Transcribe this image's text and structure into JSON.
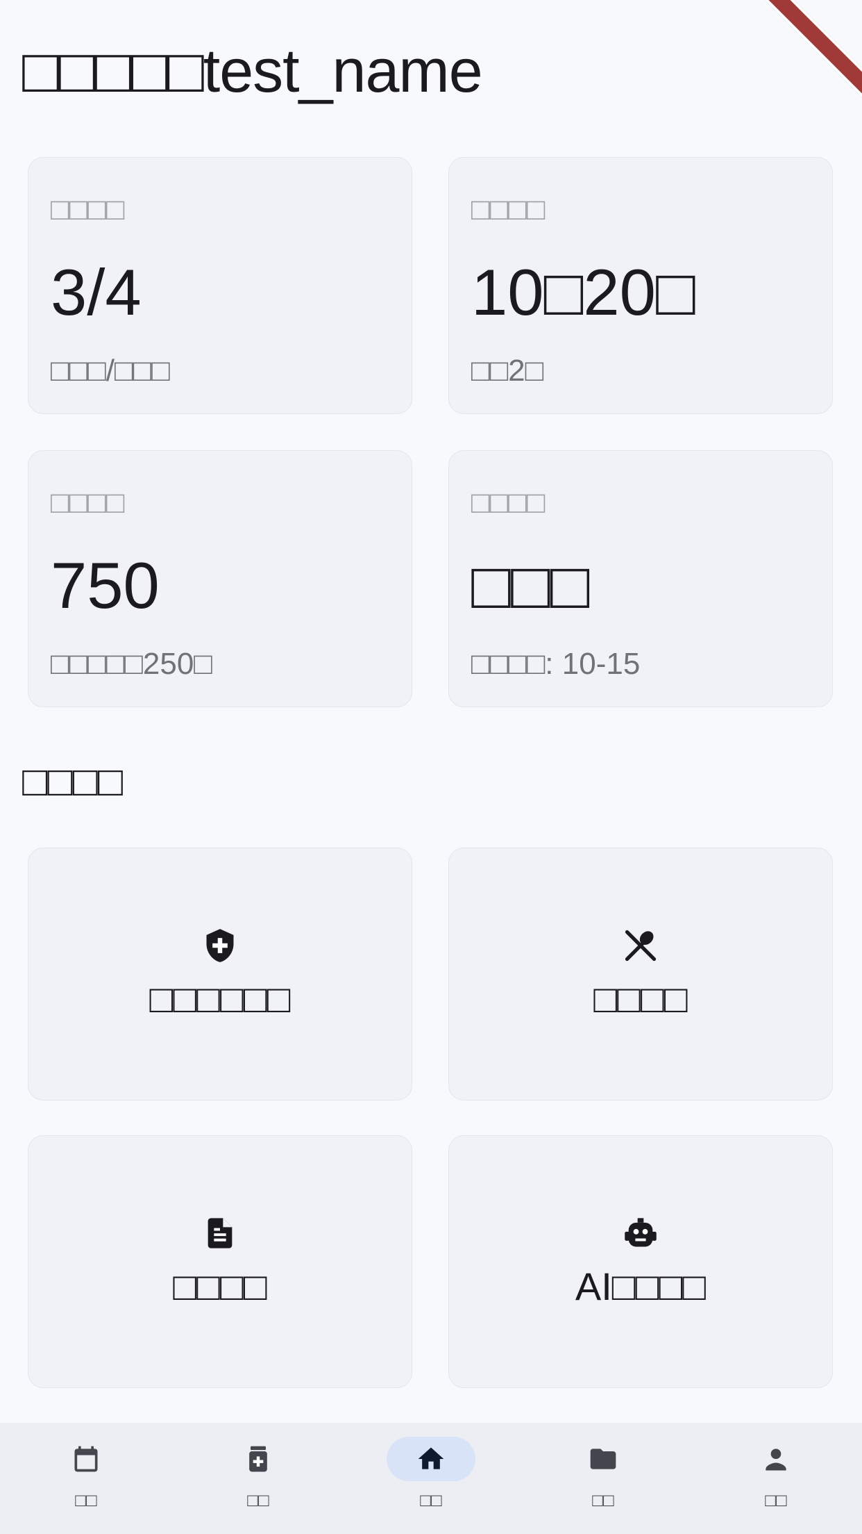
{
  "greeting": "□□□□□test_name",
  "stats": [
    {
      "label": "□□□□",
      "value": "3/4",
      "sub": "□□□/□□□"
    },
    {
      "label": "□□□□",
      "value": "10□20□",
      "sub": "□□2□"
    },
    {
      "label": "□□□□",
      "value": "750",
      "sub": "□□□□□250□"
    },
    {
      "label": "□□□□",
      "value": "□□□",
      "sub": "□□□□: 10-15"
    }
  ],
  "section_title": "□□□□",
  "actions": [
    {
      "label": "□□□□□□",
      "icon": "shield-plus-icon"
    },
    {
      "label": "□□□□",
      "icon": "fork-spoon-icon"
    },
    {
      "label": "□□□□",
      "icon": "document-icon"
    },
    {
      "label": "AI□□□□",
      "icon": "robot-icon"
    }
  ],
  "nav": [
    {
      "label": "□□",
      "icon": "calendar-icon"
    },
    {
      "label": "□□",
      "icon": "medicine-icon"
    },
    {
      "label": "□□",
      "icon": "home-icon",
      "active": true
    },
    {
      "label": "□□",
      "icon": "folder-icon"
    },
    {
      "label": "□□",
      "icon": "person-icon"
    }
  ],
  "colors": {
    "background": "#f8f9fd",
    "card": "#f1f2f8",
    "nav_active": "#d8e3f7",
    "debug_banner": "#a03a38"
  }
}
